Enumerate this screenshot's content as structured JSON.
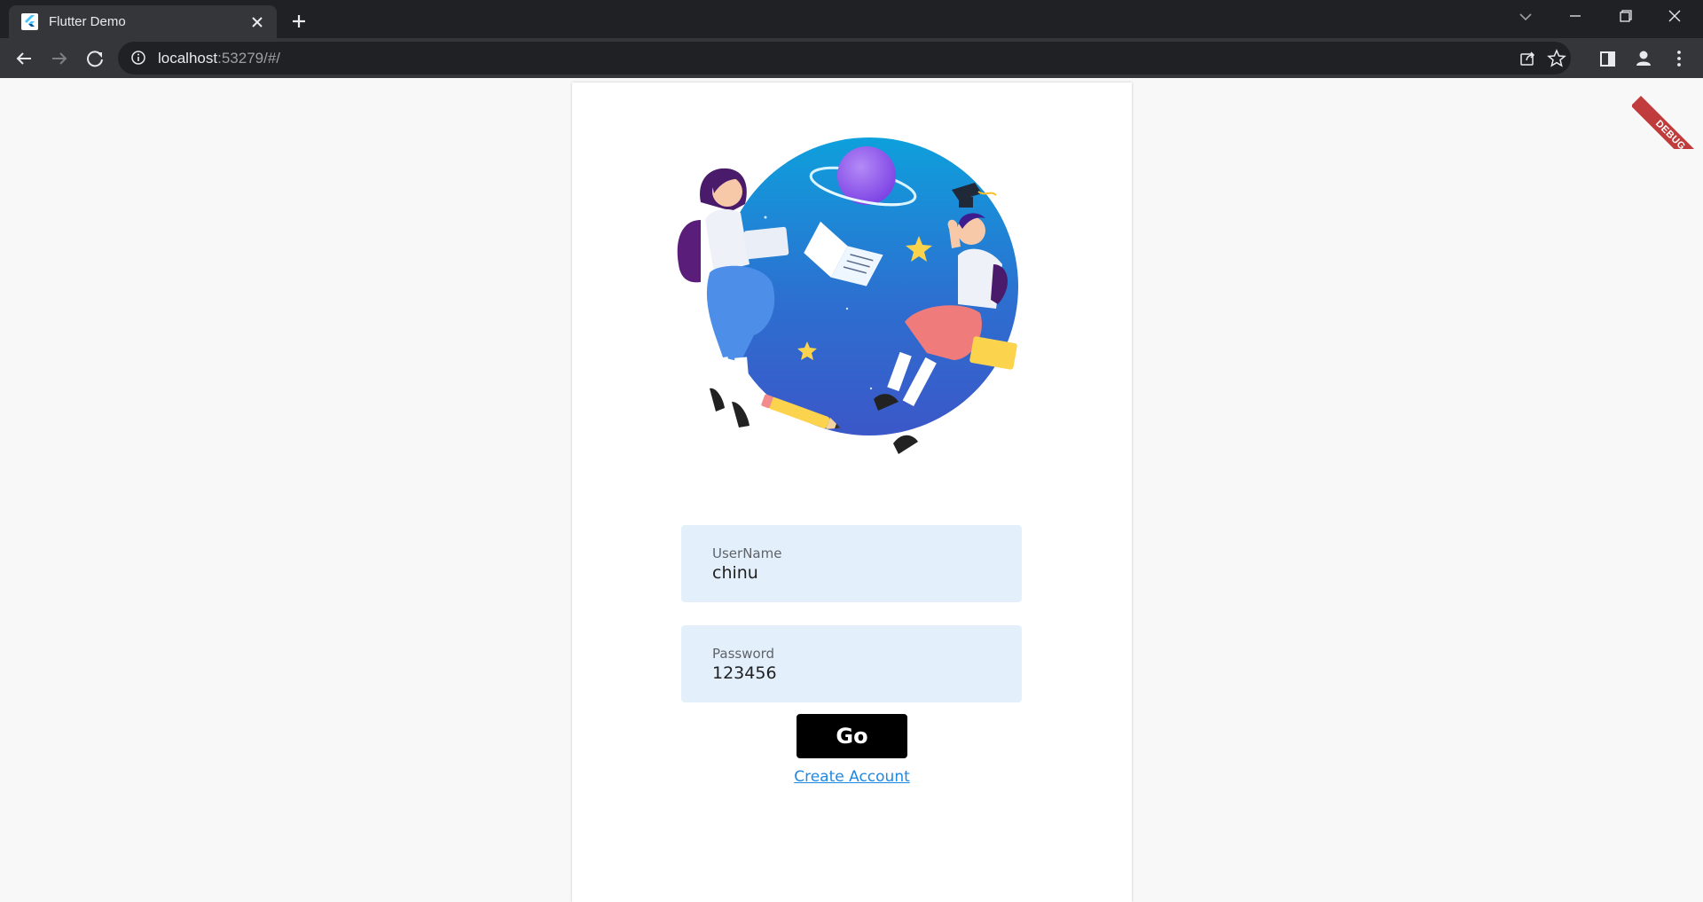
{
  "browser": {
    "tab_title": "Flutter Demo",
    "url_host": "localhost",
    "url_path": ":53279/#/"
  },
  "icons": {
    "favicon": "flutter-logo-icon",
    "close": "close-icon",
    "new_tab": "plus-icon",
    "back": "back-arrow-icon",
    "forward": "forward-arrow-icon",
    "reload": "reload-icon",
    "info": "info-icon",
    "share": "share-icon",
    "bookmark": "star-icon",
    "side_panel": "side-panel-icon",
    "profile": "profile-icon",
    "menu": "kebab-menu-icon"
  },
  "colors": {
    "field_background": "#e3f0fb",
    "button_background": "#000000",
    "link_color": "#1e88e5",
    "debug_banner": "#b71c1c"
  },
  "login": {
    "username_label": "UserName",
    "username_value": "chinu",
    "password_label": "Password",
    "password_value": "123456",
    "go_label": "Go",
    "create_account_label": "Create Account"
  },
  "debug_banner_label": "DEBUG"
}
